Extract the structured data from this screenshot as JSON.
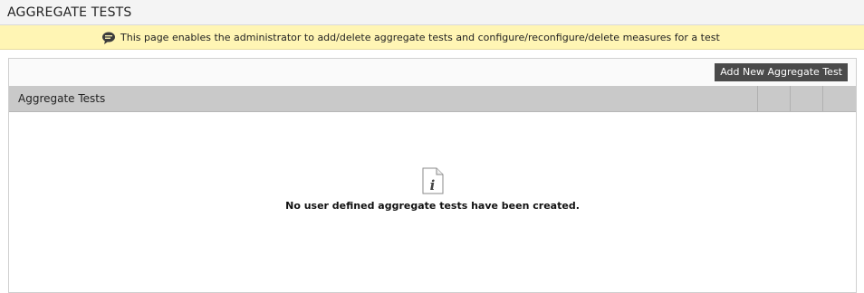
{
  "header": {
    "title": "AGGREGATE TESTS"
  },
  "banner": {
    "icon": "speech-bubble-icon",
    "text": "This page enables the administrator to add/delete aggregate tests and configure/reconfigure/delete measures for a test"
  },
  "toolbar": {
    "add_button_label": "Add New Aggregate Test"
  },
  "table": {
    "header_title": "Aggregate Tests",
    "extra_columns": 3
  },
  "empty_state": {
    "icon": "info-document-icon",
    "message": "No user defined aggregate tests have been created."
  },
  "colors": {
    "banner_background": "#fff5b4",
    "button_background": "#4a4a4a",
    "table_header_background": "#c9c9c9"
  }
}
